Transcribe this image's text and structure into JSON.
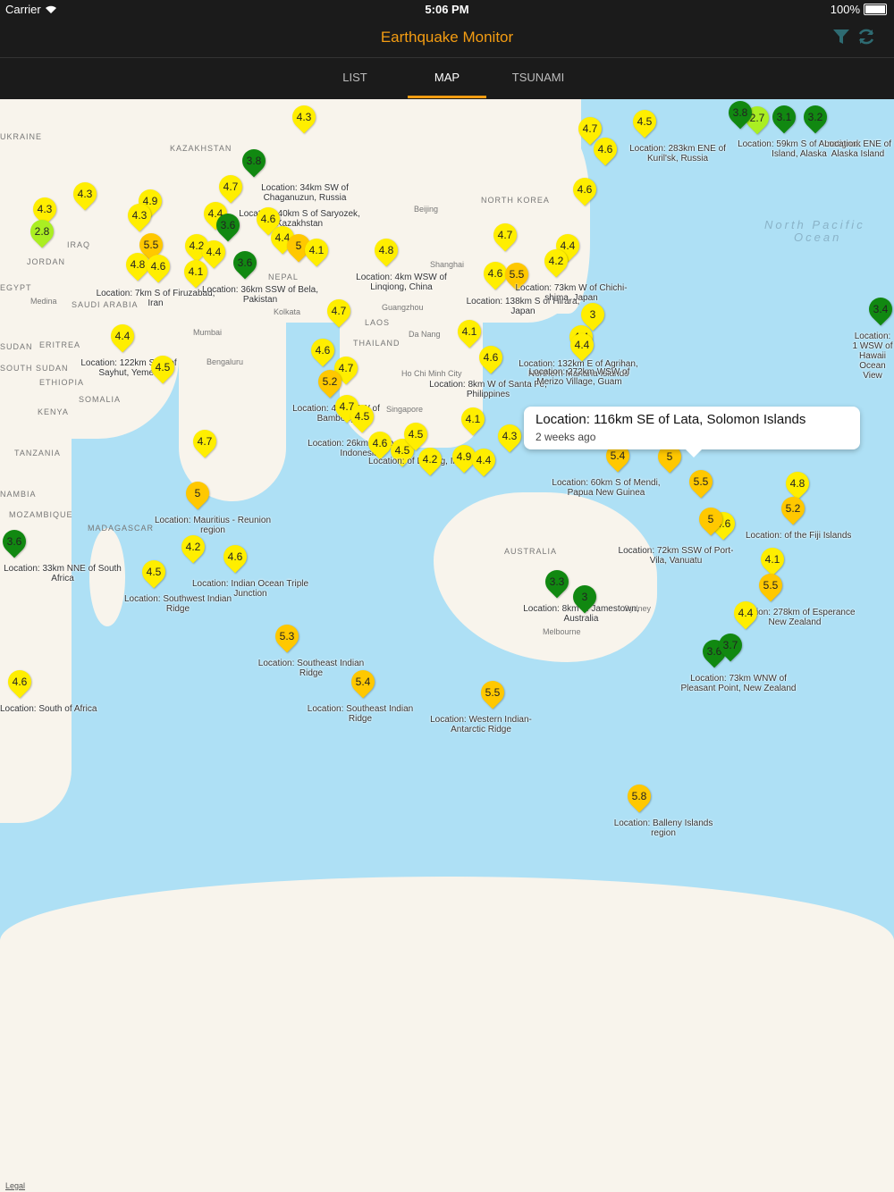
{
  "status_bar": {
    "carrier": "Carrier",
    "time": "5:06 PM",
    "battery": "100%"
  },
  "app": {
    "title": "Earthquake Monitor",
    "accent": "#f39c12"
  },
  "tabs": [
    {
      "label": "LIST",
      "active": false
    },
    {
      "label": "MAP",
      "active": true
    },
    {
      "label": "TSUNAMI",
      "active": false
    }
  ],
  "map": {
    "legal": "Legal",
    "regions": [
      "KAZAKHSTAN",
      "UKRAINE",
      "NORTH KOREA",
      "JORDAN",
      "IRAQ",
      "NEPAL",
      "EGYPT",
      "SAUDI ARABIA",
      "LAOS",
      "THAILAND",
      "ERITREA",
      "ETHIOPIA",
      "SOMALIA",
      "KENYA",
      "TANZANIA",
      "SUDAN",
      "SOUTH SUDAN",
      "MOZAMBIQUE",
      "MADAGASCAR",
      "AUSTRALIA",
      "NAMBIA"
    ],
    "cities": [
      "Beijing",
      "Shanghai",
      "Guangzhou",
      "Da Nang",
      "Ho Chi Minh City",
      "Singapore",
      "Kolkata",
      "Mumbai",
      "Bengaluru",
      "Sydney",
      "Melbourne",
      "Medina"
    ],
    "oceans": [
      "North Pacific",
      "Ocean"
    ],
    "callout": {
      "title": "Location:  116km SE of Lata, Solomon Islands",
      "subtitle": "2 weeks ago"
    },
    "quakes": [
      {
        "mag": "4.3",
        "color": "#ffee00"
      },
      {
        "mag": "3.8",
        "color": "#118811",
        "label": "Location:  34km SW of Chaganuzun, Russia"
      },
      {
        "mag": "4.7",
        "color": "#ffee00",
        "label": "Location:  40km S of Saryozek, Kazakhstan"
      },
      {
        "mag": "4.4",
        "color": "#ffee00"
      },
      {
        "mag": "3.6",
        "color": "#118811"
      },
      {
        "mag": "4.6",
        "color": "#ffee00"
      },
      {
        "mag": "4.4",
        "color": "#ffee00"
      },
      {
        "mag": "5",
        "color": "#ffc800"
      },
      {
        "mag": "4.1",
        "color": "#ffee00"
      },
      {
        "mag": "4.8",
        "color": "#ffee00",
        "label": "Location:  4km WSW of Linqiong, China"
      },
      {
        "mag": "4.3",
        "color": "#ffee00"
      },
      {
        "mag": "4.3",
        "color": "#ffee00"
      },
      {
        "mag": "4.9",
        "color": "#ffee00"
      },
      {
        "mag": "4.3",
        "color": "#ffee00"
      },
      {
        "mag": "2.8",
        "color": "#aaee22"
      },
      {
        "mag": "5.5",
        "color": "#ffc800"
      },
      {
        "mag": "4.8",
        "color": "#ffee00"
      },
      {
        "mag": "4.6",
        "color": "#ffee00",
        "label": "Location:  7km S of Firuzabad, Iran"
      },
      {
        "mag": "4.2",
        "color": "#ffee00"
      },
      {
        "mag": "4.4",
        "color": "#ffee00"
      },
      {
        "mag": "4.1",
        "color": "#ffee00"
      },
      {
        "mag": "3.6",
        "color": "#118811",
        "label": "Location:  36km SSW of Bela, Pakistan"
      },
      {
        "mag": "4.4",
        "color": "#ffee00",
        "label": "Location:  122km SSE of Sayhut, Yemen"
      },
      {
        "mag": "4.5",
        "color": "#ffee00"
      },
      {
        "mag": "4.7",
        "color": "#ffee00"
      },
      {
        "mag": "4.6",
        "color": "#ffee00"
      },
      {
        "mag": "4.7",
        "color": "#ffee00"
      },
      {
        "mag": "5.2",
        "color": "#ffc800",
        "label": "Location:  40km SW of Bambong"
      },
      {
        "mag": "4.7",
        "color": "#ffee00"
      },
      {
        "mag": "4.5",
        "color": "#ffee00",
        "label": "Location:  26km Sinabang, Indonesia"
      },
      {
        "mag": "4.6",
        "color": "#ffee00"
      },
      {
        "mag": "4.5",
        "color": "#ffee00"
      },
      {
        "mag": "4.5",
        "color": "#ffee00",
        "label": "Location:  of Batang, Indonesia"
      },
      {
        "mag": "4.2",
        "color": "#ffee00"
      },
      {
        "mag": "4.9",
        "color": "#ffee00"
      },
      {
        "mag": "4.4",
        "color": "#ffee00"
      },
      {
        "mag": "4.1",
        "color": "#ffee00"
      },
      {
        "mag": "4.3",
        "color": "#ffee00"
      },
      {
        "mag": "4.6",
        "color": "#ffee00",
        "label": "Location:  8km W of Santa Fe, Philippines"
      },
      {
        "mag": "4.1",
        "color": "#ffee00"
      },
      {
        "mag": "4.6",
        "color": "#ffee00"
      },
      {
        "mag": "5.5",
        "color": "#ffc800",
        "label": "Location:  138km S of Hirara, Japan"
      },
      {
        "mag": "4.7",
        "color": "#ffee00"
      },
      {
        "mag": "4.4",
        "color": "#ffee00"
      },
      {
        "mag": "4.2",
        "color": "#ffee00",
        "label": "Location:  73km W of Chichi-shima, Japan"
      },
      {
        "mag": "4.6",
        "color": "#ffee00"
      },
      {
        "mag": "4.5",
        "color": "#ffee00",
        "label": "Location:  283km ENE of Kuril'sk, Russia"
      },
      {
        "mag": "4.7",
        "color": "#ffee00"
      },
      {
        "mag": "4.6",
        "color": "#ffee00"
      },
      {
        "mag": "3",
        "color": "#ffee00"
      },
      {
        "mag": "4.4",
        "color": "#ffee00",
        "label": "Location:  132km E of Agrihan, Northern Mariana Islands"
      },
      {
        "mag": "4.4",
        "color": "#ffee00",
        "label": "Location:  272km WSW of Merizo Village, Guam"
      },
      {
        "mag": "2.7",
        "color": "#aaee22"
      },
      {
        "mag": "3.1",
        "color": "#118811",
        "label": "Location:  59km S of Amatignak Island, Alaska"
      },
      {
        "mag": "3.2",
        "color": "#118811",
        "label": "Location:  ENE of Alaska Island"
      },
      {
        "mag": "3.8",
        "color": "#118811"
      },
      {
        "mag": "3.4",
        "color": "#118811",
        "label": "Location:  1 WSW of Hawaii Ocean View"
      },
      {
        "mag": "5.4",
        "color": "#ffc800",
        "label": "Location:  60km S of Mendi, Papua New Guinea"
      },
      {
        "mag": "5",
        "color": "#ffc800"
      },
      {
        "mag": "5.5",
        "color": "#ffc800"
      },
      {
        "mag": "4.6",
        "color": "#ffee00",
        "label": "Location:  72km SSW of Port-Vila, Vanuatu"
      },
      {
        "mag": "5",
        "color": "#ffc800"
      },
      {
        "mag": "4.8",
        "color": "#ffee00"
      },
      {
        "mag": "5.2",
        "color": "#ffc800",
        "label": "Location:  of the Fiji Islands"
      },
      {
        "mag": "4.1",
        "color": "#ffee00"
      },
      {
        "mag": "5.5",
        "color": "#ffc800",
        "label": "Location:  278km of Esperance New Zealand"
      },
      {
        "mag": "4.4",
        "color": "#ffee00"
      },
      {
        "mag": "3.6",
        "color": "#118811",
        "label": "Location:  73km WNW of Pleasant Point, New Zealand"
      },
      {
        "mag": "3.7",
        "color": "#118811"
      },
      {
        "mag": "3.3",
        "color": "#118811",
        "label": "Location:  8km of Jamestown, Australia"
      },
      {
        "mag": "3",
        "color": "#118811"
      },
      {
        "mag": "4.7",
        "color": "#ffee00"
      },
      {
        "mag": "5",
        "color": "#ffc800",
        "label": "Location:  Mauritius - Reunion region"
      },
      {
        "mag": "4.2",
        "color": "#ffee00"
      },
      {
        "mag": "4.6",
        "color": "#ffee00",
        "label": "Location:  Indian Ocean Triple Junction"
      },
      {
        "mag": "4.5",
        "color": "#ffee00",
        "label": "Location:  Southwest Indian Ridge"
      },
      {
        "mag": "3.6",
        "color": "#118811",
        "label": "Location:  33km NNE of South Africa"
      },
      {
        "mag": "5.3",
        "color": "#ffc800",
        "label": "Location:  Southeast Indian Ridge"
      },
      {
        "mag": "5.4",
        "color": "#ffc800",
        "label": "Location:  Southeast Indian Ridge"
      },
      {
        "mag": "5.5",
        "color": "#ffc800",
        "label": "Location:  Western Indian-Antarctic Ridge"
      },
      {
        "mag": "4.6",
        "color": "#ffee00",
        "label": "Location:  South of Africa"
      },
      {
        "mag": "5.8",
        "color": "#ffc800",
        "label": "Location:  Balleny Islands region"
      }
    ]
  }
}
